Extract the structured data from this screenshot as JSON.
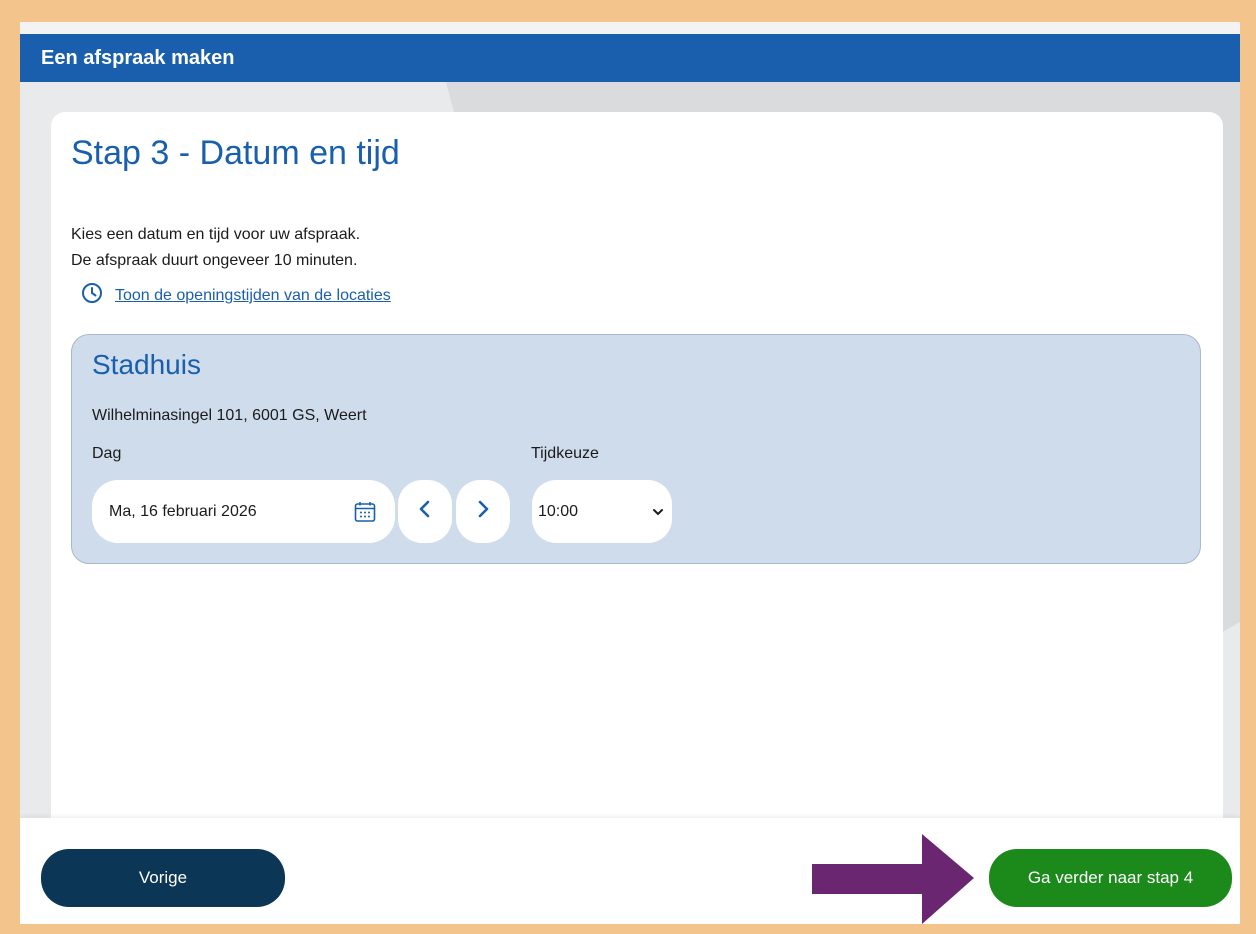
{
  "header": {
    "title": "Een afspraak maken"
  },
  "step": {
    "title": "Stap 3 - Datum en tijd",
    "intro_line1": "Kies een datum en tijd voor uw afspraak.",
    "intro_line2": "De afspraak duurt ongeveer 10 minuten.",
    "hours_link": "Toon de openingstijden van de locaties"
  },
  "location": {
    "name": "Stadhuis",
    "address": "Wilhelminasingel 101, 6001 GS, Weert",
    "day_label": "Dag",
    "day_value": "Ma, 16 februari 2026",
    "time_label": "Tijdkeuze",
    "time_value": "10:00"
  },
  "footer": {
    "prev_label": "Vorige",
    "next_label": "Ga verder naar stap 4"
  },
  "icons": {
    "clock": "clock-icon",
    "calendar": "calendar-icon",
    "prev": "chevron-left-icon",
    "next": "chevron-right-icon",
    "dropdown": "chevron-down-icon",
    "annotation": "arrow-right-icon"
  },
  "colors": {
    "header_bg": "#1a5fae",
    "primary_text": "#1a5fae",
    "location_bg": "#cfdcec",
    "prev_button": "#0c3655",
    "next_button": "#1b8a1b",
    "annotation_arrow": "#6a2670",
    "frame_border": "#f4c48d"
  }
}
